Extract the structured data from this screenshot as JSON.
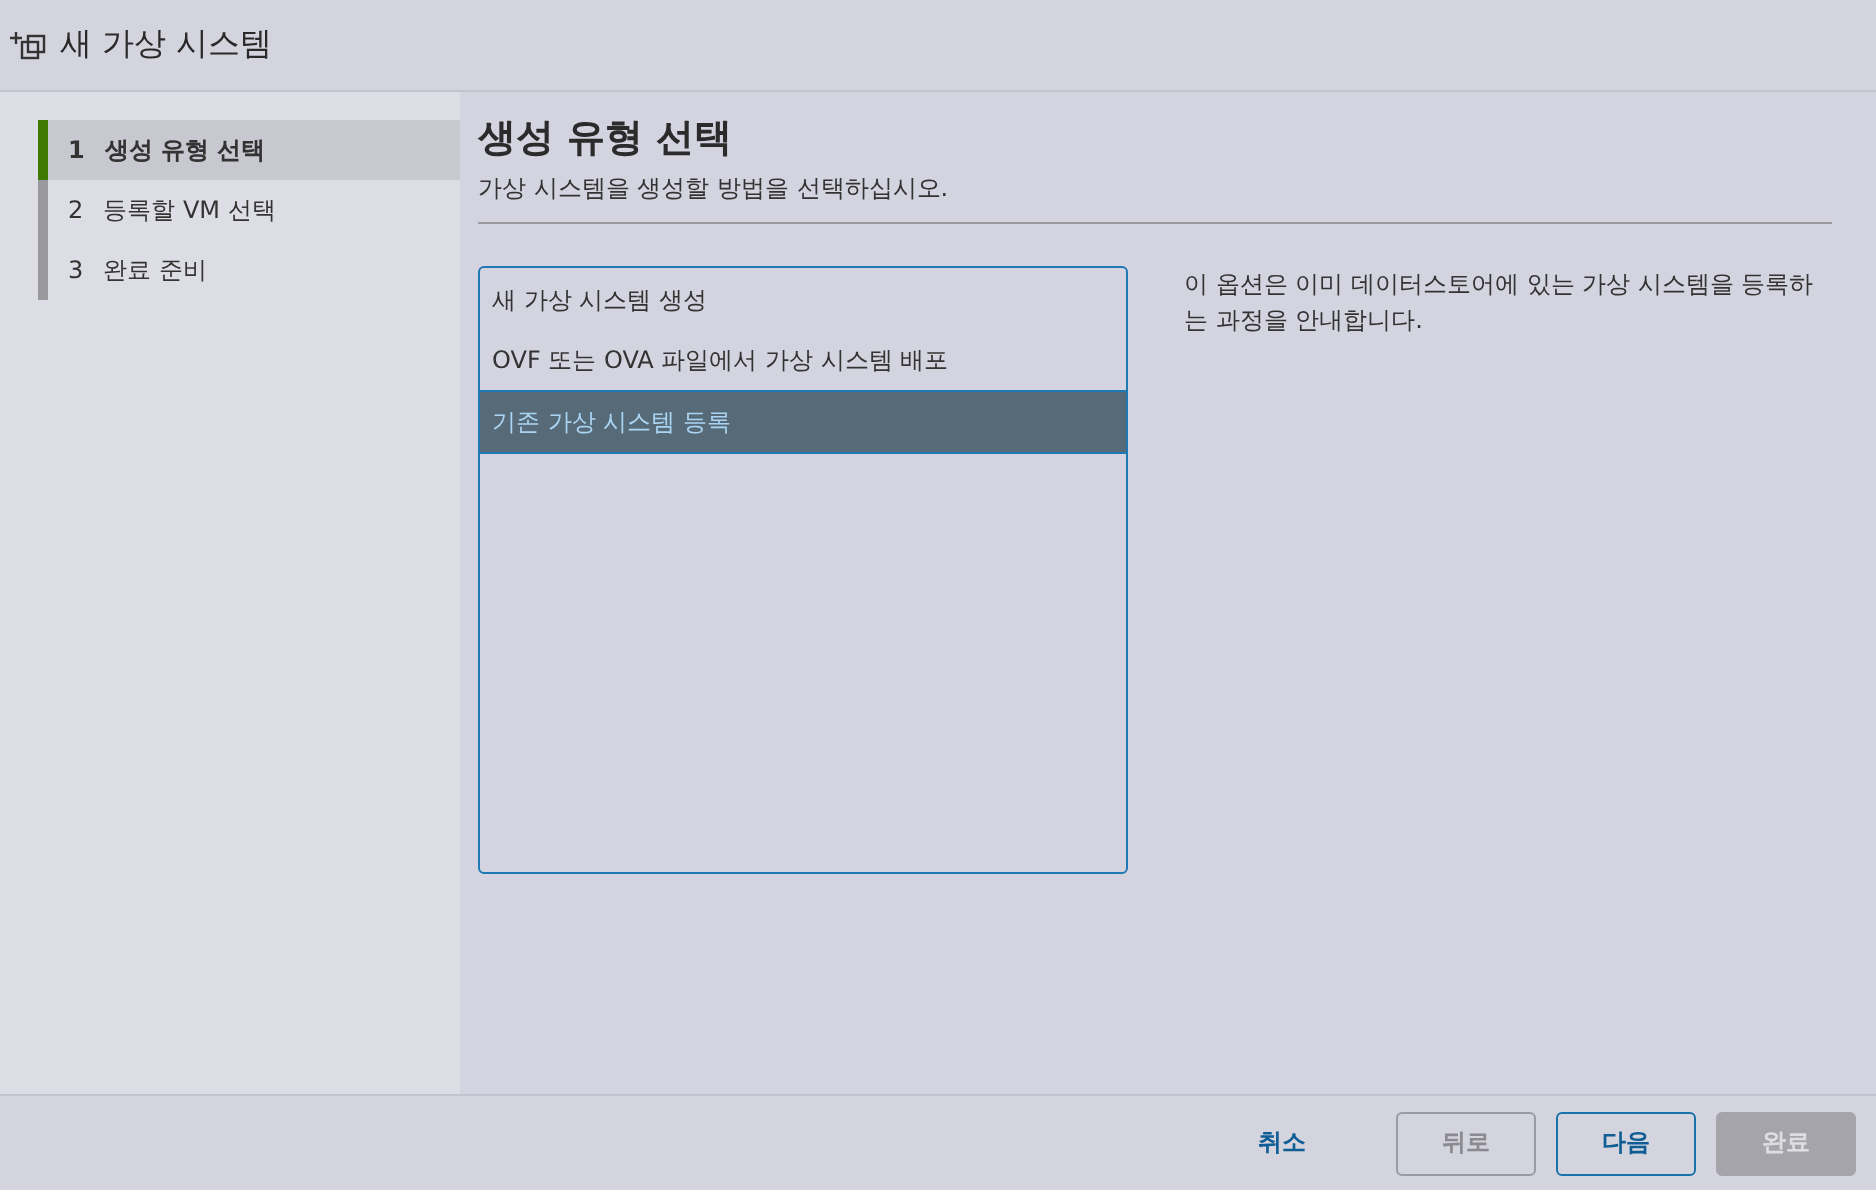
{
  "window": {
    "title": "새 가상 시스템"
  },
  "steps": [
    {
      "number": "1",
      "label": "생성 유형 선택",
      "selected": true
    },
    {
      "number": "2",
      "label": "등록할 VM 선택",
      "selected": false
    },
    {
      "number": "3",
      "label": "완료 준비",
      "selected": false
    }
  ],
  "page": {
    "heading": "생성 유형 선택",
    "subtitle": "가상 시스템을 생성할 방법을 선택하십시오."
  },
  "options": [
    {
      "label": "새 가상 시스템 생성",
      "selected": false
    },
    {
      "label": "OVF 또는 OVA 파일에서 가상 시스템 배포",
      "selected": false
    },
    {
      "label": "기존 가상 시스템 등록",
      "selected": true
    }
  ],
  "description": "이 옵션은 이미 데이터스토어에 있는 가상 시스템을 등록하는 과정을 안내합니다.",
  "buttons": [
    {
      "label": "취소",
      "kind": "link",
      "disabled": false
    },
    {
      "label": "뒤로",
      "kind": "outline",
      "disabled": true
    },
    {
      "label": "다음",
      "kind": "outline",
      "disabled": false
    },
    {
      "label": "완료",
      "kind": "solid",
      "disabled": true
    }
  ]
}
